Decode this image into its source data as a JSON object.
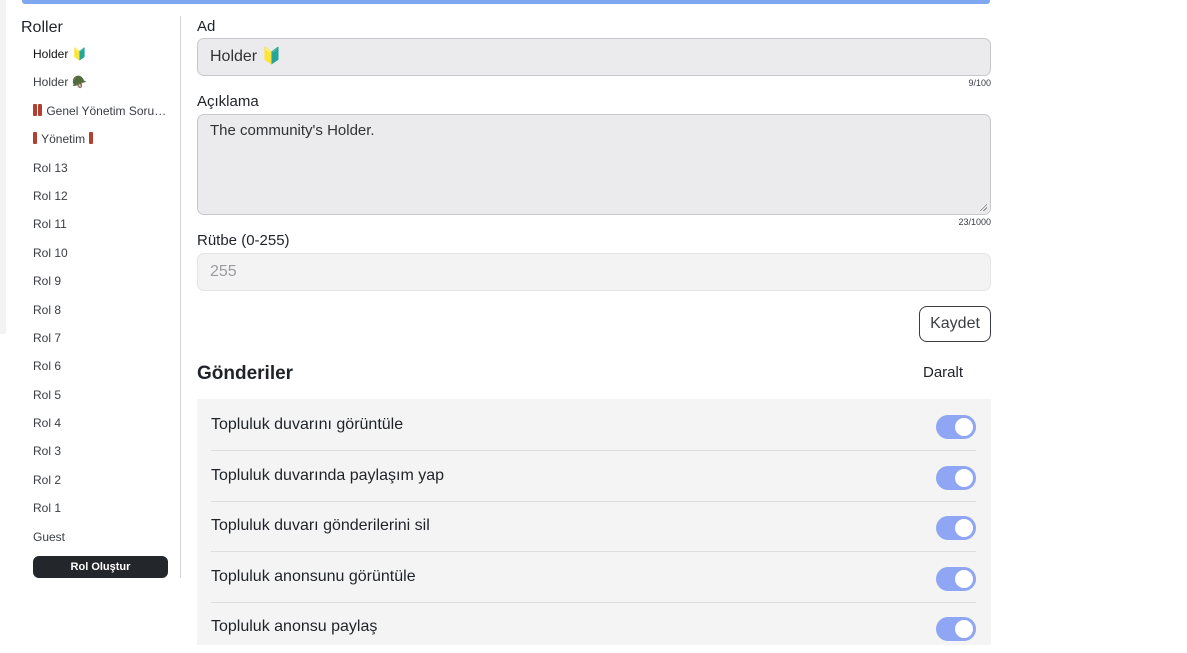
{
  "sidebar": {
    "title": "Roller",
    "roles": [
      {
        "label": "Holder",
        "suffix": "🔰",
        "active": true
      },
      {
        "label": "Holder",
        "suffix": "🪖",
        "active": false
      },
      {
        "label": "Genel Yönetim Sorumlusu",
        "prefix_bars": 2,
        "active": false
      },
      {
        "label": "Yönetim",
        "prefix_bars": 1,
        "suffix_bars": 1,
        "active": false
      },
      {
        "label": "Rol 13"
      },
      {
        "label": "Rol 12"
      },
      {
        "label": "Rol 11"
      },
      {
        "label": "Rol 10"
      },
      {
        "label": "Rol 9"
      },
      {
        "label": "Rol 8"
      },
      {
        "label": "Rol 7"
      },
      {
        "label": "Rol 6"
      },
      {
        "label": "Rol 5"
      },
      {
        "label": "Rol 4"
      },
      {
        "label": "Rol 3"
      },
      {
        "label": "Rol 2"
      },
      {
        "label": "Rol 1"
      },
      {
        "label": "Guest"
      }
    ],
    "create_button": "Rol Oluştur"
  },
  "form": {
    "name_label": "Ad",
    "name_value": "Holder 🔰",
    "name_counter": "9/100",
    "description_label": "Açıklama",
    "description_value": "The community's Holder.",
    "description_counter": "23/1000",
    "rank_label": "Rütbe (0-255)",
    "rank_value": "255",
    "save_button": "Kaydet"
  },
  "permissions": {
    "section_title": "Gönderiler",
    "collapse_label": "Daralt",
    "items": [
      {
        "label": "Topluluk duvarını görüntüle",
        "enabled": true
      },
      {
        "label": "Topluluk duvarında paylaşım yap",
        "enabled": true
      },
      {
        "label": "Topluluk duvarı gönderilerini sil",
        "enabled": true
      },
      {
        "label": "Topluluk anonsunu görüntüle",
        "enabled": true
      },
      {
        "label": "Topluluk anonsu paylaş",
        "enabled": true
      }
    ]
  },
  "colors": {
    "accent_bar": "#7fa7ef",
    "toggle_on": "#8ea6f3",
    "create_button_bg": "#23262b"
  }
}
